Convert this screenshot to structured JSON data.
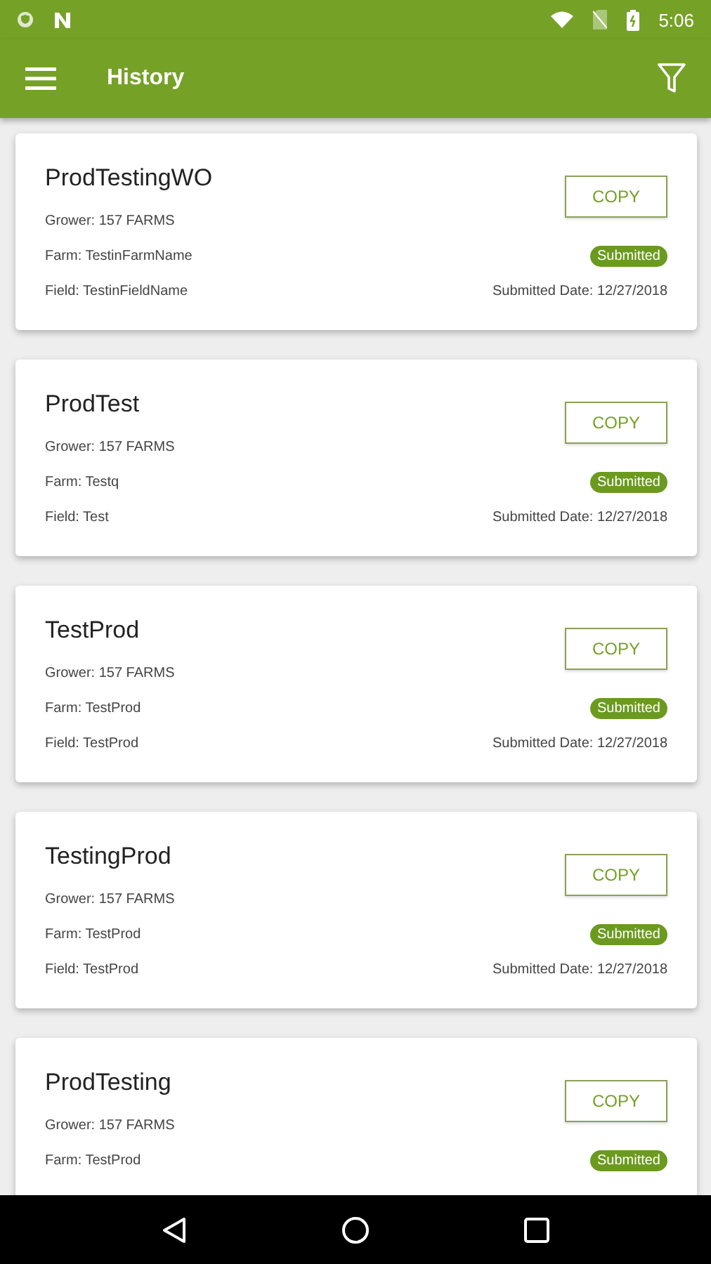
{
  "status_bar": {
    "time": "5:06"
  },
  "app_bar": {
    "title": "History"
  },
  "records": [
    {
      "title": "ProdTestingWO",
      "grower": "Grower: 157 FARMS",
      "farm": "Farm: TestinFarmName",
      "field": "Field: TestinFieldName",
      "button": "COPY",
      "status": "Submitted",
      "date": "Submitted Date: 12/27/2018"
    },
    {
      "title": "ProdTest",
      "grower": "Grower: 157 FARMS",
      "farm": "Farm: Testq",
      "field": "Field: Test",
      "button": "COPY",
      "status": "Submitted",
      "date": "Submitted Date: 12/27/2018"
    },
    {
      "title": "TestProd",
      "grower": "Grower: 157 FARMS",
      "farm": "Farm: TestProd",
      "field": "Field: TestProd",
      "button": "COPY",
      "status": "Submitted",
      "date": "Submitted Date: 12/27/2018"
    },
    {
      "title": "TestingProd",
      "grower": "Grower: 157 FARMS",
      "farm": "Farm: TestProd",
      "field": "Field: TestProd",
      "button": "COPY",
      "status": "Submitted",
      "date": "Submitted Date: 12/27/2018"
    },
    {
      "title": "ProdTesting",
      "grower": "Grower: 157 FARMS",
      "farm": "Farm: TestProd",
      "button": "COPY",
      "status": "Submitted"
    }
  ]
}
